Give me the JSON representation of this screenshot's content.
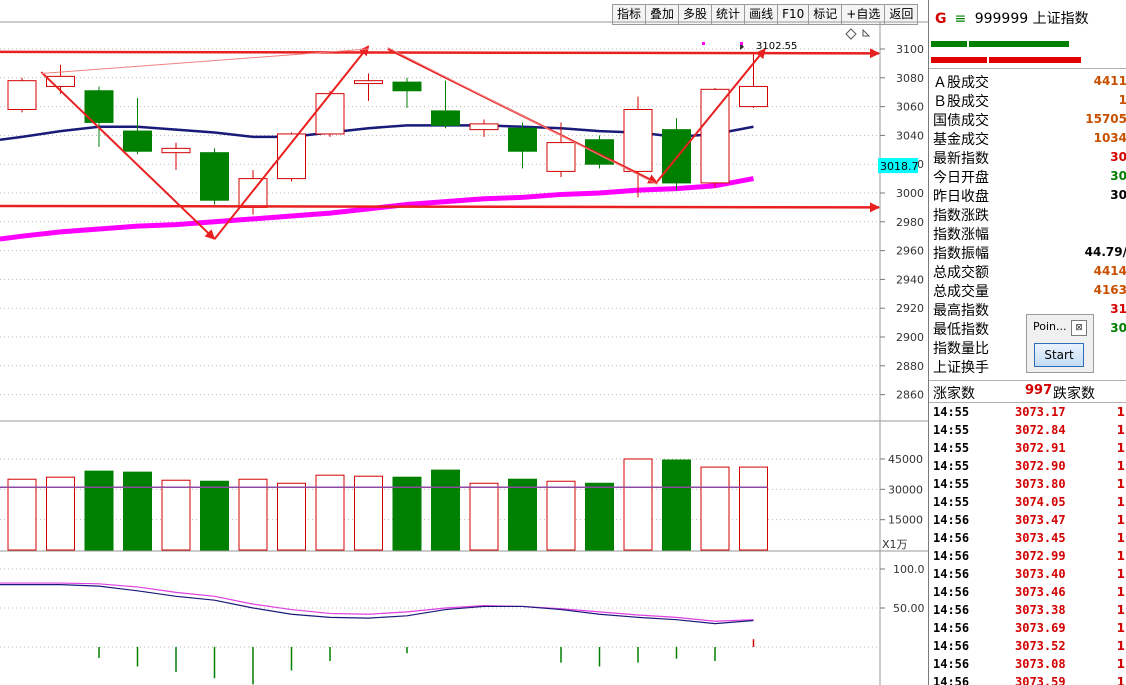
{
  "toolbar": {
    "buttons": [
      "指标",
      "叠加",
      "多股",
      "统计",
      "画线",
      "F10",
      "标记",
      "+自选",
      "返回"
    ]
  },
  "chart_data": [
    {
      "type": "candlestick",
      "ylim": [
        2845,
        3115
      ],
      "y_ticks": [
        3100,
        3080,
        3060,
        3040,
        3020,
        3000,
        2980,
        2960,
        2940,
        2920,
        2900,
        2880,
        2860
      ],
      "y_tick_labels": [
        "3100",
        "3080",
        "3060",
        "3040",
        "3020",
        "3000",
        "2980",
        "2960",
        "2940",
        "2920",
        "2900",
        "2880",
        "2860"
      ],
      "candles": [
        {
          "o": 3058,
          "c": 3078,
          "h": 3080,
          "l": 3056
        },
        {
          "o": 3074,
          "c": 3081,
          "h": 3089,
          "l": 3069
        },
        {
          "o": 3071,
          "c": 3049,
          "h": 3074,
          "l": 3032
        },
        {
          "o": 3043,
          "c": 3029,
          "h": 3066,
          "l": 3027
        },
        {
          "o": 3028,
          "c": 3031,
          "h": 3035,
          "l": 3016
        },
        {
          "o": 3028,
          "c": 2995,
          "h": 3031,
          "l": 2992
        },
        {
          "o": 2990,
          "c": 3010,
          "h": 3016,
          "l": 2985
        },
        {
          "o": 3010,
          "c": 3041,
          "h": 3042,
          "l": 3008
        },
        {
          "o": 3041,
          "c": 3069,
          "h": 3071,
          "l": 3039
        },
        {
          "o": 3076,
          "c": 3078,
          "h": 3083,
          "l": 3064
        },
        {
          "o": 3077,
          "c": 3071,
          "h": 3080,
          "l": 3059
        },
        {
          "o": 3057,
          "c": 3047,
          "h": 3078,
          "l": 3045
        },
        {
          "o": 3044,
          "c": 3048,
          "h": 3051,
          "l": 3039
        },
        {
          "o": 3045,
          "c": 3029,
          "h": 3049,
          "l": 3017
        },
        {
          "o": 3015,
          "c": 3035,
          "h": 3049,
          "l": 3011
        },
        {
          "o": 3037,
          "c": 3020,
          "h": 3040,
          "l": 3017
        },
        {
          "o": 3015,
          "c": 3058,
          "h": 3067,
          "l": 2997
        },
        {
          "o": 3044,
          "c": 3007,
          "h": 3052,
          "l": 3002
        },
        {
          "o": 3007,
          "c": 3072,
          "h": 3073,
          "l": 3004
        },
        {
          "o": 3060,
          "c": 3074,
          "h": 3098,
          "l": 3059
        }
      ],
      "ma_navy": [
        3039,
        3043,
        3046,
        3046,
        3044,
        3042,
        3039,
        3039,
        3042,
        3045,
        3047,
        3047,
        3047,
        3046,
        3045,
        3043,
        3042,
        3039,
        3041,
        3046
      ],
      "ma_magenta": [
        2970,
        2973,
        2975,
        2977,
        2978,
        2980,
        2982,
        2984,
        2986,
        2989,
        2992,
        2994,
        2996,
        2997,
        2999,
        3000,
        3002,
        3003,
        3005,
        3010
      ],
      "last_price_label": "3018.7",
      "high_label": "3102.55",
      "annotation_lines": [
        {
          "x1": -1.5,
          "y1": 3098,
          "x2": 23.5,
          "y2": 3097
        },
        {
          "x1": -2,
          "y1": 2991,
          "x2": 23.5,
          "y2": 2990
        },
        {
          "x1": 0.5,
          "y1": 3084,
          "x2": 5,
          "y2": 2968
        },
        {
          "x1": 5,
          "y1": 2968,
          "x2": 9,
          "y2": 3102
        },
        {
          "x1": 9.5,
          "y1": 3100,
          "x2": 16.5,
          "y2": 3007
        },
        {
          "x1": 16.5,
          "y1": 3008,
          "x2": 19.3,
          "y2": 3100
        }
      ]
    },
    {
      "type": "bar",
      "ylim": [
        0,
        60000
      ],
      "y_ticks": [
        45000,
        30000,
        15000
      ],
      "y_tick_labels": [
        "45000",
        "30000",
        "15000"
      ],
      "unit_label": "X1万",
      "values": [
        35000,
        36000,
        39000,
        38500,
        34500,
        34000,
        35000,
        33000,
        37000,
        36500,
        36000,
        39500,
        33000,
        35000,
        34000,
        33000,
        45000,
        44500,
        41000,
        41000
      ],
      "ma_value": 31000
    },
    {
      "type": "line",
      "ylim": [
        0,
        120
      ],
      "y_ticks": [
        100,
        50
      ],
      "y_tick_labels": [
        "100.0",
        "50.00"
      ],
      "line_pink": [
        82,
        82,
        81,
        77,
        70,
        65,
        55,
        48,
        43,
        42,
        45,
        50,
        53,
        52,
        49,
        45,
        41,
        38,
        33,
        35
      ],
      "line_navy": [
        80,
        80,
        78,
        72,
        65,
        60,
        50,
        42,
        38,
        37,
        40,
        48,
        52,
        52,
        48,
        42,
        38,
        35,
        30,
        34
      ],
      "bars": [
        0,
        0,
        -14,
        -25,
        -32,
        -40,
        -48,
        -30,
        -18,
        0,
        -8,
        0,
        0,
        0,
        -20,
        -25,
        -20,
        -15,
        -18,
        10
      ]
    }
  ],
  "panel": {
    "header_g": "G",
    "header_icon": "≡",
    "code": "999999",
    "name": "上证指数",
    "labels": [
      "Ａ股成交",
      "Ｂ股成交",
      "国债成交",
      "基金成交",
      "最新指数",
      "今日开盘",
      "昨日收盘",
      "指数涨跌",
      "指数涨幅",
      "指数振幅",
      "总成交额",
      "总成交量",
      "最高指数",
      "最低指数",
      "指数量比",
      "上证换手"
    ],
    "values": [
      "4411",
      "1",
      "15705",
      "1034",
      "30",
      "30",
      "30",
      "",
      "",
      "44.79/",
      "4414",
      "4163",
      "31",
      "30",
      "",
      ""
    ],
    "value_colors": [
      "#c85000",
      "#c85000",
      "#c85000",
      "#c85000",
      "#d40000",
      "#008000",
      "#000000",
      "#000000",
      "#000000",
      "#000000",
      "#c85000",
      "#c85000",
      "#d40000",
      "#008000",
      "#000000",
      "#000000"
    ],
    "up_label": "涨家数",
    "up_count": "997",
    "down_label": "跌家数",
    "ticks": [
      {
        "time": "14:55",
        "price": "3073.17",
        "vol": "1"
      },
      {
        "time": "14:55",
        "price": "3072.84",
        "vol": "1"
      },
      {
        "time": "14:55",
        "price": "3072.91",
        "vol": "1"
      },
      {
        "time": "14:55",
        "price": "3072.90",
        "vol": "1"
      },
      {
        "time": "14:55",
        "price": "3073.80",
        "vol": "1"
      },
      {
        "time": "14:55",
        "price": "3074.05",
        "vol": "1"
      },
      {
        "time": "14:56",
        "price": "3073.47",
        "vol": "1"
      },
      {
        "time": "14:56",
        "price": "3073.45",
        "vol": "1"
      },
      {
        "time": "14:56",
        "price": "3072.99",
        "vol": "1"
      },
      {
        "time": "14:56",
        "price": "3073.40",
        "vol": "1"
      },
      {
        "time": "14:56",
        "price": "3073.46",
        "vol": "1"
      },
      {
        "time": "14:56",
        "price": "3073.38",
        "vol": "1"
      },
      {
        "time": "14:56",
        "price": "3073.69",
        "vol": "1"
      },
      {
        "time": "14:56",
        "price": "3073.52",
        "vol": "1"
      },
      {
        "time": "14:56",
        "price": "3073.08",
        "vol": "1"
      },
      {
        "time": "14:56",
        "price": "3073.59",
        "vol": "1"
      }
    ]
  },
  "popup": {
    "title": "Poin...",
    "close": "⊠",
    "button": "Start"
  },
  "colors": {
    "up": "#d40000",
    "down": "#008000",
    "ma_navy": "#1a1a7a",
    "ma_magenta": "#ff00ff",
    "arrow": "#e82020",
    "price_tag": "#00ffff"
  }
}
